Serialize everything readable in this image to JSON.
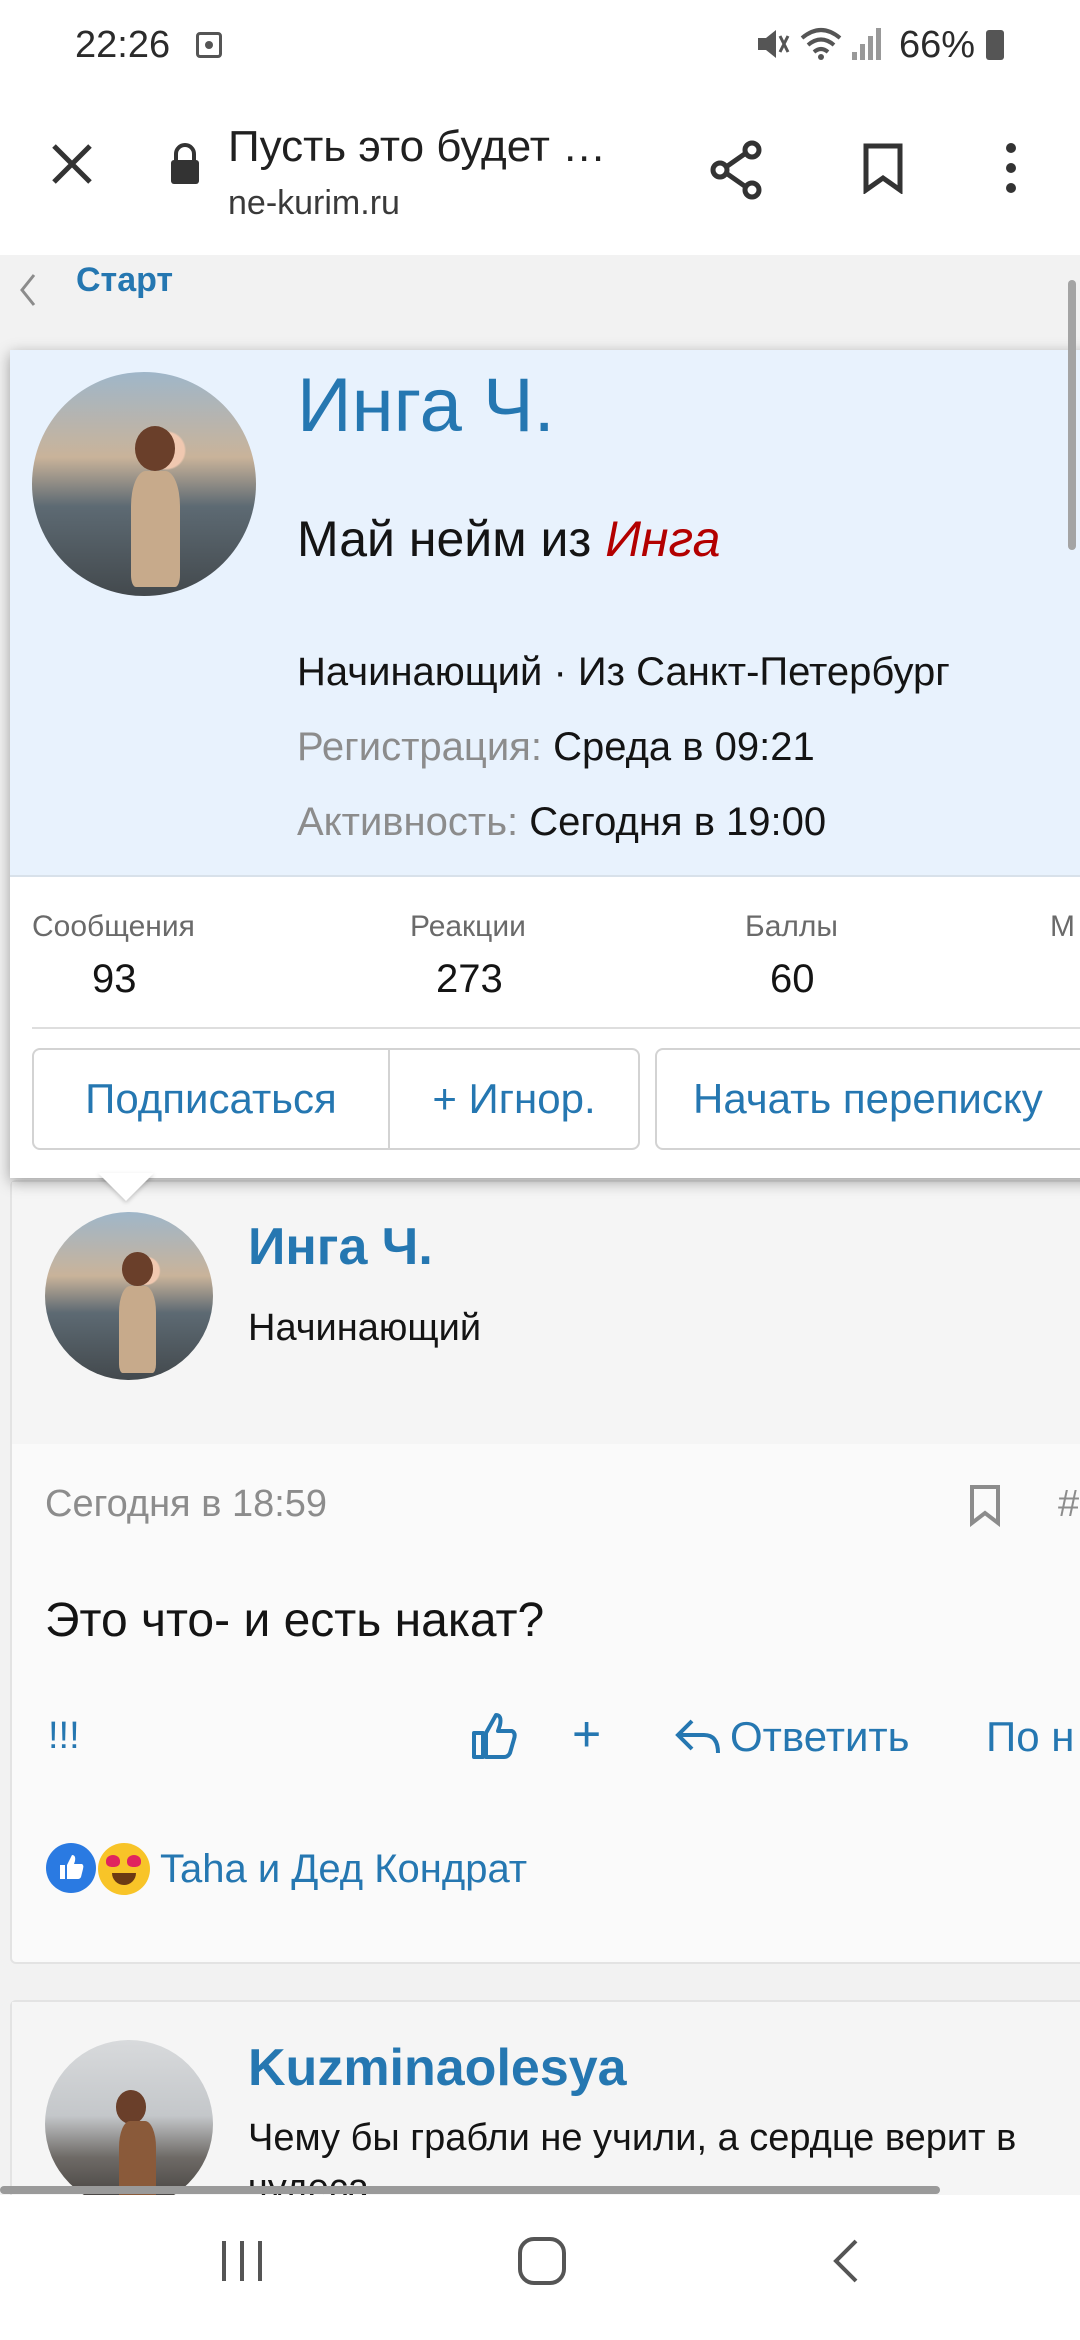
{
  "status_bar": {
    "time": "22:26",
    "battery": "66%",
    "icons": [
      "gallery-notification-icon",
      "mute-icon",
      "wifi-icon",
      "signal-icon",
      "battery-icon"
    ]
  },
  "browser": {
    "title": "Пусть это будет …",
    "domain": "ne-kurim.ru",
    "icons": [
      "close-icon",
      "lock-icon",
      "share-icon",
      "bookmark-icon",
      "more-vert-icon"
    ]
  },
  "breadcrumb": {
    "label": "Старт"
  },
  "popup": {
    "name": "Инга Ч.",
    "custom_title_prefix": "Май нейм из ",
    "custom_title_highlight": "Инга",
    "rank_line": "Начинающий · Из Санкт-Петербург",
    "registration_label": "Регистрация:",
    "registration_value": "Среда в 09:21",
    "activity_label": "Активность:",
    "activity_value": "Сегодня в 19:00",
    "stats": [
      {
        "label": "Сообщения",
        "value": "93"
      },
      {
        "label": "Реакции",
        "value": "273"
      },
      {
        "label": "Баллы",
        "value": "60"
      },
      {
        "label": "М",
        "value": ""
      }
    ],
    "buttons": {
      "follow": "Подписаться",
      "ignore": "+ Игнор.",
      "start_conversation": "Начать переписку"
    }
  },
  "post1": {
    "author": "Инга Ч.",
    "role": "Начинающий",
    "timestamp": "Сегодня в 18:59",
    "hash": "#",
    "text": "Это что- и есть накат?",
    "actions": {
      "report": "!!!",
      "plus": "+",
      "reply": "Ответить",
      "more": "По н"
    },
    "reactions_text": "Taha и Дед Кондрат"
  },
  "post2": {
    "author": "Kuzminaolesya",
    "signature": "Чему бы грабли не учили, а сердце верит в",
    "signature_line2": "чудеса"
  },
  "colors": {
    "link": "#2577b1",
    "highlight_red": "#b30000",
    "popup_bg": "#e8f2fd"
  }
}
